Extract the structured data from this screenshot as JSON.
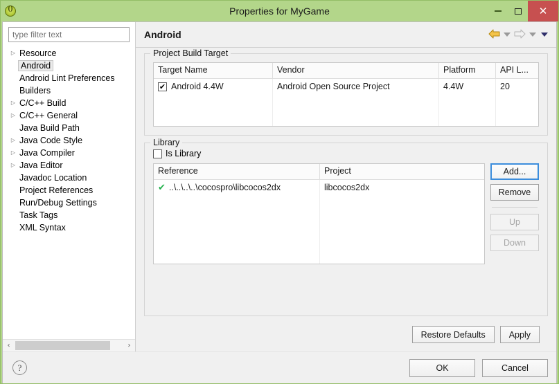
{
  "window": {
    "title": "Properties for MyGame",
    "app_icon": "eclipse-icon",
    "minimize_label": "Minimize",
    "maximize_label": "Maximize",
    "close_label": "✕",
    "close_color": "#c75050",
    "titlebar_color": "#b3d68a"
  },
  "sidebar": {
    "filter": {
      "value": "",
      "placeholder": "type filter text"
    },
    "items": [
      {
        "label": "Resource",
        "expandable": true,
        "selected": false
      },
      {
        "label": "Android",
        "expandable": false,
        "selected": true
      },
      {
        "label": "Android Lint Preferences",
        "expandable": false,
        "selected": false
      },
      {
        "label": "Builders",
        "expandable": false,
        "selected": false
      },
      {
        "label": "C/C++ Build",
        "expandable": true,
        "selected": false
      },
      {
        "label": "C/C++ General",
        "expandable": true,
        "selected": false
      },
      {
        "label": "Java Build Path",
        "expandable": false,
        "selected": false
      },
      {
        "label": "Java Code Style",
        "expandable": true,
        "selected": false
      },
      {
        "label": "Java Compiler",
        "expandable": true,
        "selected": false
      },
      {
        "label": "Java Editor",
        "expandable": true,
        "selected": false
      },
      {
        "label": "Javadoc Location",
        "expandable": false,
        "selected": false
      },
      {
        "label": "Project References",
        "expandable": false,
        "selected": false
      },
      {
        "label": "Run/Debug Settings",
        "expandable": false,
        "selected": false
      },
      {
        "label": "Task Tags",
        "expandable": false,
        "selected": false
      },
      {
        "label": "XML Syntax",
        "expandable": false,
        "selected": false
      }
    ],
    "scroll_left_icon": "‹",
    "scroll_right_icon": "›"
  },
  "page": {
    "title": "Android",
    "nav": {
      "back_icon": "back-arrow-icon",
      "forward_icon": "forward-arrow-icon",
      "menu_icon": "chevron-down-icon"
    }
  },
  "build_target": {
    "group_title": "Project Build Target",
    "columns": [
      "Target Name",
      "Vendor",
      "Platform",
      "API L..."
    ],
    "rows": [
      {
        "checked": true,
        "check_glyph": "✔",
        "target_name": "Android 4.4W",
        "vendor": "Android Open Source Project",
        "platform": "4.4W",
        "api_level": "20"
      }
    ]
  },
  "library": {
    "group_title": "Library",
    "is_library": {
      "label": "Is Library",
      "checked": false
    },
    "columns": [
      "Reference",
      "Project"
    ],
    "rows": [
      {
        "status_glyph": "✔",
        "reference": "..\\..\\..\\..\\cocospro\\libcocos2dx",
        "project": "libcocos2dx"
      }
    ],
    "buttons": [
      {
        "label": "Add...",
        "enabled": true,
        "focused": true
      },
      {
        "label": "Remove",
        "enabled": true,
        "focused": false
      },
      {
        "label": "Up",
        "enabled": false,
        "focused": false
      },
      {
        "label": "Down",
        "enabled": false,
        "focused": false
      }
    ]
  },
  "actions": {
    "restore_defaults": "Restore Defaults",
    "apply": "Apply",
    "ok": "OK",
    "cancel": "Cancel",
    "help_glyph": "?"
  }
}
